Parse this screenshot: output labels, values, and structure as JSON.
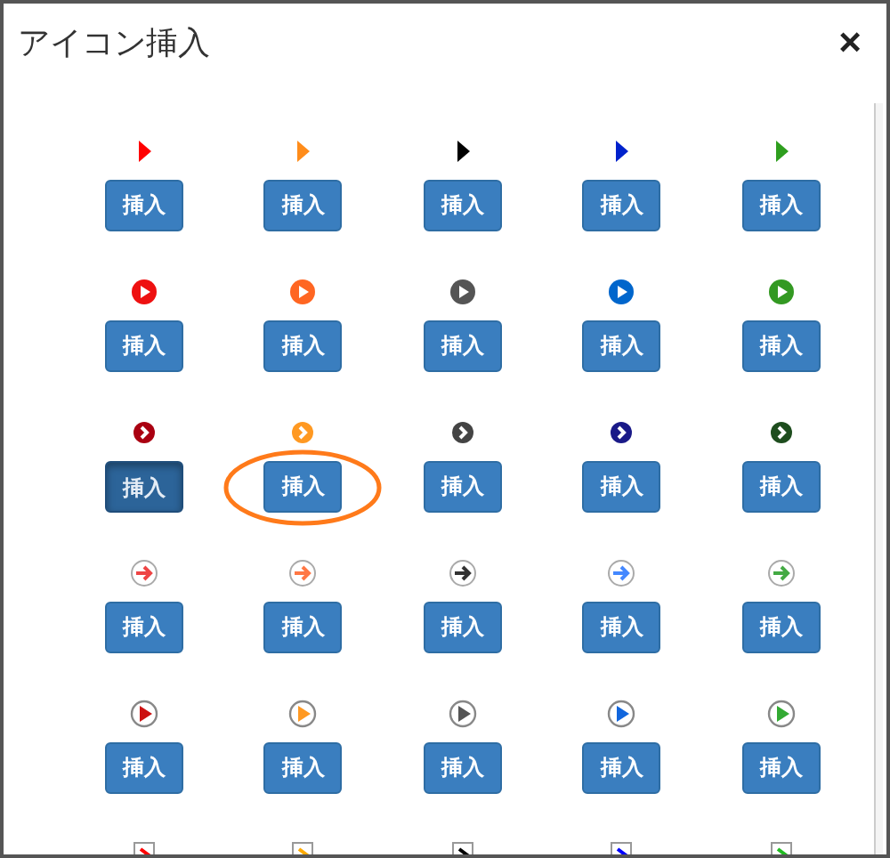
{
  "dialog": {
    "title": "アイコン挿入",
    "close": "×"
  },
  "rows": [
    {
      "kind": "triangle",
      "items": [
        {
          "color": "#ff0000",
          "button": "挿入",
          "pressed": false,
          "circled": false
        },
        {
          "color": "#ff8c1a",
          "button": "挿入",
          "pressed": false,
          "circled": false
        },
        {
          "color": "#000000",
          "button": "挿入",
          "pressed": false,
          "circled": false
        },
        {
          "color": "#0022cc",
          "button": "挿入",
          "pressed": false,
          "circled": false
        },
        {
          "color": "#2e9e1e",
          "button": "挿入",
          "pressed": false,
          "circled": false
        }
      ]
    },
    {
      "kind": "circle-play",
      "items": [
        {
          "color": "#ee1111",
          "button": "挿入",
          "pressed": false,
          "circled": false
        },
        {
          "color": "#ff6622",
          "button": "挿入",
          "pressed": false,
          "circled": false
        },
        {
          "color": "#555555",
          "button": "挿入",
          "pressed": false,
          "circled": false
        },
        {
          "color": "#0066cc",
          "button": "挿入",
          "pressed": false,
          "circled": false
        },
        {
          "color": "#339922",
          "button": "挿入",
          "pressed": false,
          "circled": false
        }
      ]
    },
    {
      "kind": "circle-chevron",
      "items": [
        {
          "color": "#aa0011",
          "button": "挿入",
          "pressed": true,
          "circled": false
        },
        {
          "color": "#ff9922",
          "button": "挿入",
          "pressed": false,
          "circled": true
        },
        {
          "color": "#444444",
          "button": "挿入",
          "pressed": false,
          "circled": false
        },
        {
          "color": "#1a1a88",
          "button": "挿入",
          "pressed": false,
          "circled": false
        },
        {
          "color": "#1e4d1e",
          "button": "挿入",
          "pressed": false,
          "circled": false
        }
      ]
    },
    {
      "kind": "ring-arrow",
      "items": [
        {
          "color": "#ee4444",
          "button": "挿入",
          "pressed": false,
          "circled": false
        },
        {
          "color": "#ff7744",
          "button": "挿入",
          "pressed": false,
          "circled": false
        },
        {
          "color": "#333333",
          "button": "挿入",
          "pressed": false,
          "circled": false
        },
        {
          "color": "#4488ff",
          "button": "挿入",
          "pressed": false,
          "circled": false
        },
        {
          "color": "#44aa44",
          "button": "挿入",
          "pressed": false,
          "circled": false
        }
      ]
    },
    {
      "kind": "ring-play",
      "items": [
        {
          "color": "#cc1111",
          "button": "挿入",
          "pressed": false,
          "circled": false
        },
        {
          "color": "#ff9922",
          "button": "挿入",
          "pressed": false,
          "circled": false
        },
        {
          "color": "#555555",
          "button": "挿入",
          "pressed": false,
          "circled": false
        },
        {
          "color": "#1166dd",
          "button": "挿入",
          "pressed": false,
          "circled": false
        },
        {
          "color": "#33aa33",
          "button": "挿入",
          "pressed": false,
          "circled": false
        }
      ]
    },
    {
      "kind": "box-chevron",
      "items": [
        {
          "color": "#ff0000"
        },
        {
          "color": "#ffaa00"
        },
        {
          "color": "#000000"
        },
        {
          "color": "#0000ff"
        },
        {
          "color": "#22bb22"
        }
      ]
    }
  ]
}
